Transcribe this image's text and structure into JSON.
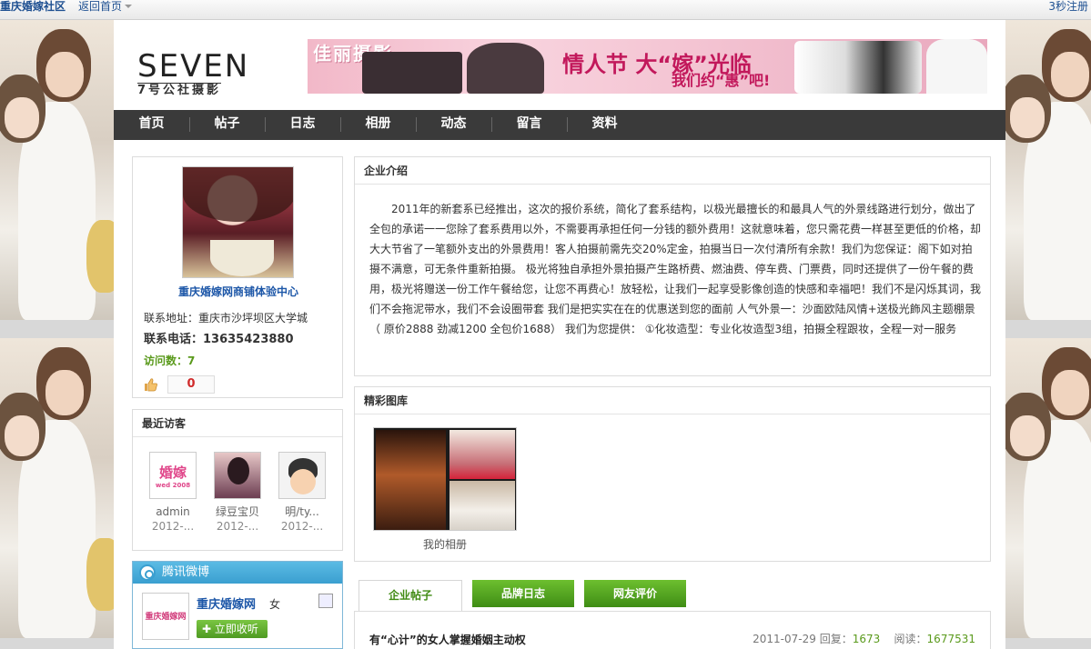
{
  "topbar": {
    "site_name": "重庆婚嫁社区",
    "home_link": "返回首页",
    "register": "3秒注册"
  },
  "header": {
    "logo_main": "SEVEN",
    "logo_sub": "7号公社摄影",
    "banner_left": "佳丽摄影",
    "banner_title": "情人节 大“嫁”光临",
    "banner_sub": "我们约“惠”吧!"
  },
  "nav": {
    "items": [
      "首页",
      "帖子",
      "日志",
      "相册",
      "动态",
      "留言",
      "资料"
    ]
  },
  "profile": {
    "shop_name": "重庆婚嫁网商铺体验中心",
    "address": "联系地址：重庆市沙坪坝区大学城",
    "tel": "联系电话：13635423880",
    "visits": "访问数：7",
    "likes": "0"
  },
  "visitors": {
    "title": "最近访客",
    "items": [
      {
        "name": "admin",
        "date": "2012-...",
        "thumb_text": "婚嫁",
        "thumb_sub": "wed 2008"
      },
      {
        "name": "绿豆宝贝",
        "date": "2012-..."
      },
      {
        "name": "明/ty...",
        "date": "2012-..."
      }
    ]
  },
  "weibo": {
    "title": "腾讯微博",
    "avatar_text": "重庆婚嫁网",
    "name": "重庆婚嫁网",
    "gender": "女",
    "follow": "立即收听"
  },
  "intro": {
    "title": "企业介绍",
    "text": "2011年的新套系已经推出，这次的报价系统，简化了套系结构，以极光最擅长的和最具人气的外景线路进行划分，做出了全包的承诺一一您除了套系费用以外，不需要再承担任何一分钱的额外费用！这就意味着，您只需花费一样甚至更低的价格，却大大节省了一笔额外支出的外景费用！客人拍摄前需先交20%定金，拍摄当日一次付清所有余款！我们为您保证：阁下如对拍摄不满意，可无条件重新拍摄。 极光将独自承担外景拍摄产生路桥费、燃油费、停车费、门票费，同时还提供了一份午餐的费用，极光将赠送一份工作午餐给您，让您不再费心！放轻松，让我们一起享受影像创造的快感和幸福吧！我们不是闪烁其词，我们不会拖泥带水，我们不会设圈带套 我们是把实实在在的优惠送到您的面前 人气外景一：沙面欧陆风情+送极光飾风主题棚景 （ 原价2888 劲减1200 全包价1688） 我们为您提供： ①化妆造型：专业化妆造型3组，拍摄全程跟妆，全程一对一服务"
  },
  "gallery": {
    "title": "精彩图库",
    "album_label": "我的相册"
  },
  "tabs": {
    "items": [
      "企业帖子",
      "品牌日志",
      "网友评价"
    ]
  },
  "posts": {
    "items": [
      {
        "title": "有“心计”的女人掌握婚姻主动权",
        "date": "2011-07-29",
        "reply_label": "回复：",
        "replies": "1673",
        "read_label": "阅读：",
        "reads": "1677531"
      }
    ]
  }
}
